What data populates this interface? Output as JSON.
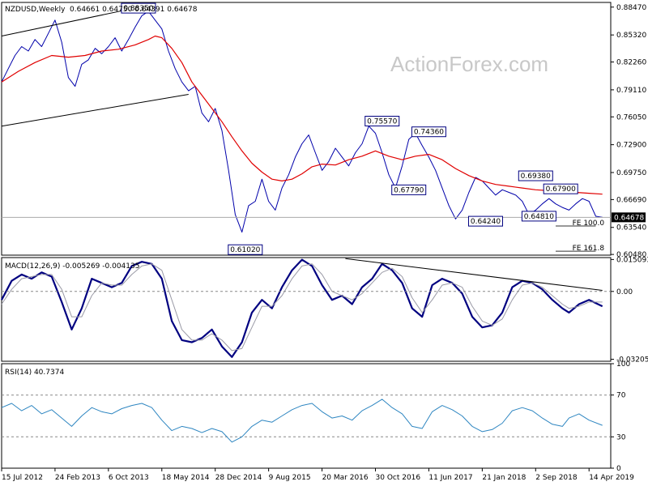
{
  "chart_data": [
    {
      "type": "line",
      "pane": "price",
      "title": "NZDUSD,Weekly",
      "ohlc": "0.64661 0.64750 0.64391 0.64678",
      "watermark": "ActionForex.com",
      "ylim": [
        0.604,
        0.89
      ],
      "yticks": [
        {
          "v": 0.8847,
          "label": "0.88470"
        },
        {
          "v": 0.8532,
          "label": "0.85320"
        },
        {
          "v": 0.8226,
          "label": "0.82260"
        },
        {
          "v": 0.7911,
          "label": "0.79110"
        },
        {
          "v": 0.7605,
          "label": "0.76050"
        },
        {
          "v": 0.729,
          "label": "0.72900"
        },
        {
          "v": 0.6975,
          "label": "0.69750"
        },
        {
          "v": 0.6669,
          "label": "0.66690"
        },
        {
          "v": 0.6354,
          "label": "0.63540"
        },
        {
          "v": 0.6048,
          "label": "0.60480"
        }
      ],
      "current": {
        "v": 0.64678,
        "label": "0.64678"
      },
      "series": [
        {
          "name": "",
          "color": "#0000aa",
          "x": [
            0,
            4,
            8,
            12,
            16,
            20,
            24,
            28,
            32,
            36,
            40,
            44,
            48,
            52,
            56,
            60,
            64,
            68,
            72,
            76,
            80,
            84,
            88,
            92,
            96,
            100,
            104,
            108,
            112,
            116,
            120,
            124,
            128,
            132,
            136,
            140,
            144,
            148,
            152,
            156,
            160,
            164,
            168,
            172,
            176,
            180,
            184,
            188,
            192,
            196,
            200,
            204,
            208,
            212,
            216,
            220,
            224,
            228,
            232,
            236,
            240,
            244,
            248,
            252,
            256,
            260,
            264,
            268,
            272,
            276,
            280,
            284,
            288,
            292,
            296,
            300,
            304,
            308,
            312,
            316,
            320,
            324,
            328,
            332,
            336,
            340,
            344,
            348,
            352,
            356,
            360
          ],
          "values": [
            0.8,
            0.815,
            0.83,
            0.84,
            0.835,
            0.848,
            0.84,
            0.855,
            0.87,
            0.845,
            0.805,
            0.795,
            0.82,
            0.825,
            0.838,
            0.832,
            0.84,
            0.85,
            0.835,
            0.848,
            0.862,
            0.875,
            0.88,
            0.87,
            0.86,
            0.835,
            0.815,
            0.8,
            0.79,
            0.795,
            0.765,
            0.755,
            0.77,
            0.745,
            0.7,
            0.65,
            0.63,
            0.66,
            0.665,
            0.69,
            0.665,
            0.655,
            0.68,
            0.695,
            0.715,
            0.73,
            0.74,
            0.72,
            0.7,
            0.71,
            0.725,
            0.715,
            0.705,
            0.72,
            0.73,
            0.75,
            0.742,
            0.72,
            0.695,
            0.68,
            0.705,
            0.735,
            0.742,
            0.728,
            0.715,
            0.7,
            0.68,
            0.66,
            0.645,
            0.655,
            0.675,
            0.692,
            0.688,
            0.68,
            0.672,
            0.678,
            0.675,
            0.672,
            0.665,
            0.65,
            0.655,
            0.662,
            0.668,
            0.662,
            0.658,
            0.655,
            0.662,
            0.668,
            0.665,
            0.648,
            0.6468
          ]
        },
        {
          "name": "",
          "color": "#e00000",
          "x": [
            0,
            10,
            20,
            30,
            40,
            50,
            60,
            70,
            80,
            88,
            92,
            96,
            102,
            108,
            114,
            120,
            126,
            132,
            138,
            144,
            150,
            156,
            162,
            168,
            174,
            180,
            186,
            192,
            200,
            208,
            216,
            224,
            232,
            240,
            248,
            256,
            264,
            272,
            280,
            288,
            296,
            304,
            312,
            320,
            328,
            336,
            344,
            352,
            360
          ],
          "values": [
            0.8,
            0.812,
            0.822,
            0.83,
            0.828,
            0.83,
            0.835,
            0.837,
            0.842,
            0.848,
            0.852,
            0.85,
            0.838,
            0.822,
            0.8,
            0.785,
            0.77,
            0.755,
            0.738,
            0.722,
            0.708,
            0.698,
            0.69,
            0.688,
            0.69,
            0.696,
            0.704,
            0.707,
            0.706,
            0.712,
            0.716,
            0.722,
            0.716,
            0.712,
            0.716,
            0.718,
            0.712,
            0.702,
            0.694,
            0.688,
            0.684,
            0.682,
            0.68,
            0.678,
            0.677,
            0.676,
            0.675,
            0.674,
            0.673
          ]
        }
      ],
      "annotations": [
        {
          "label": "0.88350",
          "x": 82,
          "v": 0.8835
        },
        {
          "label": "0.61020",
          "x": 146,
          "v": 0.6102
        },
        {
          "label": "0.75570",
          "x": 228,
          "v": 0.7557
        },
        {
          "label": "0.74360",
          "x": 256,
          "v": 0.7436
        },
        {
          "label": "0.67790",
          "x": 244,
          "v": 0.6779
        },
        {
          "label": "0.69380",
          "x": 320,
          "v": 0.6938
        },
        {
          "label": "0.67900",
          "x": 335,
          "v": 0.679
        },
        {
          "label": "0.64240",
          "x": 290,
          "v": 0.6424
        },
        {
          "label": "0.64810",
          "x": 322,
          "v": 0.6481
        }
      ],
      "fe_labels": [
        {
          "label": "FE 100.0",
          "v": 0.637
        },
        {
          "label": "FE 161.8",
          "v": 0.6085
        }
      ]
    },
    {
      "type": "line",
      "pane": "macd",
      "title": "MACD(12,26,9) -0.005269 -0.004135",
      "ylim": [
        -0.033,
        0.016
      ],
      "yticks": [
        {
          "v": 0.015093,
          "label": "0.015093"
        },
        {
          "v": 0.0,
          "label": "0.00"
        },
        {
          "v": -0.032057,
          "label": "-0.032057"
        }
      ],
      "current": {
        "v": 0.0,
        "label": "0.00"
      },
      "series": [
        {
          "name": "MACD",
          "color": "#000080",
          "x": [
            0,
            6,
            12,
            18,
            24,
            30,
            36,
            42,
            48,
            54,
            60,
            66,
            72,
            78,
            84,
            90,
            96,
            102,
            108,
            114,
            120,
            126,
            132,
            138,
            144,
            150,
            156,
            162,
            168,
            174,
            180,
            186,
            192,
            198,
            204,
            210,
            216,
            222,
            228,
            234,
            240,
            246,
            252,
            258,
            264,
            270,
            276,
            282,
            288,
            294,
            300,
            306,
            312,
            318,
            324,
            330,
            336,
            340,
            346,
            352,
            360
          ],
          "values": [
            -0.004,
            0.005,
            0.008,
            0.006,
            0.009,
            0.007,
            -0.005,
            -0.018,
            -0.008,
            0.006,
            0.004,
            0.002,
            0.004,
            0.012,
            0.014,
            0.013,
            0.006,
            -0.014,
            -0.023,
            -0.024,
            -0.022,
            -0.018,
            -0.026,
            -0.031,
            -0.024,
            -0.01,
            -0.004,
            -0.008,
            0.002,
            0.01,
            0.015,
            0.012,
            0.003,
            -0.004,
            -0.002,
            -0.006,
            0.002,
            0.006,
            0.013,
            0.01,
            0.004,
            -0.008,
            -0.012,
            0.003,
            0.006,
            0.004,
            -0.001,
            -0.012,
            -0.017,
            -0.016,
            -0.01,
            0.002,
            0.005,
            0.004,
            0.001,
            -0.004,
            -0.008,
            -0.01,
            -0.006,
            -0.004,
            -0.007
          ]
        },
        {
          "name": "Signal",
          "color": "#9a9aa6",
          "x": [
            0,
            6,
            12,
            18,
            24,
            30,
            36,
            42,
            48,
            54,
            60,
            66,
            72,
            78,
            84,
            90,
            96,
            102,
            108,
            114,
            120,
            126,
            132,
            138,
            144,
            150,
            156,
            162,
            168,
            174,
            180,
            186,
            192,
            198,
            204,
            210,
            216,
            222,
            228,
            234,
            240,
            246,
            252,
            258,
            264,
            270,
            276,
            282,
            288,
            294,
            300,
            306,
            312,
            318,
            324,
            330,
            336,
            340,
            346,
            352,
            360
          ],
          "values": [
            -0.006,
            0.001,
            0.006,
            0.007,
            0.008,
            0.008,
            0.001,
            -0.012,
            -0.012,
            -0.002,
            0.004,
            0.003,
            0.003,
            0.008,
            0.012,
            0.013,
            0.01,
            -0.004,
            -0.018,
            -0.023,
            -0.023,
            -0.02,
            -0.023,
            -0.028,
            -0.027,
            -0.017,
            -0.007,
            -0.007,
            -0.002,
            0.006,
            0.012,
            0.013,
            0.008,
            0.0,
            -0.002,
            -0.004,
            -0.001,
            0.004,
            0.009,
            0.011,
            0.007,
            -0.003,
            -0.01,
            -0.004,
            0.003,
            0.004,
            0.002,
            -0.007,
            -0.014,
            -0.016,
            -0.013,
            -0.004,
            0.003,
            0.004,
            0.002,
            -0.002,
            -0.006,
            -0.008,
            -0.007,
            -0.005,
            -0.005
          ]
        }
      ],
      "trendline": {
        "x1": 206,
        "v1": 0.0155,
        "x2": 360,
        "v2": 0.0005
      }
    },
    {
      "type": "line",
      "pane": "rsi",
      "title": "RSI(14) 40.7374",
      "ylim": [
        0,
        100
      ],
      "yticks": [
        {
          "v": 100,
          "label": "100"
        },
        {
          "v": 70,
          "label": "70"
        },
        {
          "v": 30,
          "label": "30"
        },
        {
          "v": 0,
          "label": "0"
        }
      ],
      "levels": [
        70,
        30
      ],
      "series": [
        {
          "name": "RSI",
          "color": "#2e86c1",
          "x": [
            0,
            6,
            12,
            18,
            24,
            30,
            36,
            42,
            48,
            54,
            60,
            66,
            72,
            78,
            84,
            90,
            96,
            102,
            108,
            114,
            120,
            126,
            132,
            138,
            144,
            150,
            156,
            162,
            168,
            174,
            180,
            186,
            192,
            198,
            204,
            210,
            216,
            222,
            228,
            234,
            240,
            246,
            252,
            258,
            264,
            270,
            276,
            282,
            288,
            294,
            300,
            306,
            312,
            318,
            324,
            330,
            336,
            340,
            346,
            352,
            360
          ],
          "values": [
            58,
            62,
            55,
            60,
            52,
            56,
            48,
            40,
            50,
            58,
            54,
            52,
            57,
            60,
            62,
            58,
            46,
            36,
            40,
            38,
            34,
            38,
            35,
            25,
            30,
            40,
            46,
            44,
            50,
            56,
            60,
            62,
            54,
            48,
            50,
            46,
            55,
            60,
            66,
            58,
            52,
            40,
            38,
            54,
            60,
            56,
            50,
            40,
            35,
            37,
            43,
            55,
            58,
            55,
            48,
            42,
            40,
            48,
            52,
            46,
            41
          ]
        }
      ]
    }
  ],
  "x_axis": {
    "labels": [
      {
        "x": 0,
        "label": "15 Jul 2012"
      },
      {
        "x": 32,
        "label": "24 Feb 2013"
      },
      {
        "x": 64,
        "label": "6 Oct 2013"
      },
      {
        "x": 96,
        "label": "18 May 2014"
      },
      {
        "x": 128,
        "label": "28 Dec 2014"
      },
      {
        "x": 160,
        "label": "9 Aug 2015"
      },
      {
        "x": 192,
        "label": "20 Mar 2016"
      },
      {
        "x": 224,
        "label": "30 Oct 2016"
      },
      {
        "x": 256,
        "label": "11 Jun 2017"
      },
      {
        "x": 288,
        "label": "21 Jan 2018"
      },
      {
        "x": 320,
        "label": "2 Sep 2018"
      },
      {
        "x": 352,
        "label": "14 Apr 2019"
      }
    ]
  },
  "colors": {
    "background": "#ffffff",
    "frame": "#000000",
    "price": "#0000aa",
    "ma": "#e00000",
    "macd": "#000080",
    "signal": "#9a9aa6",
    "rsi": "#2e86c1",
    "guide": "#000000"
  }
}
